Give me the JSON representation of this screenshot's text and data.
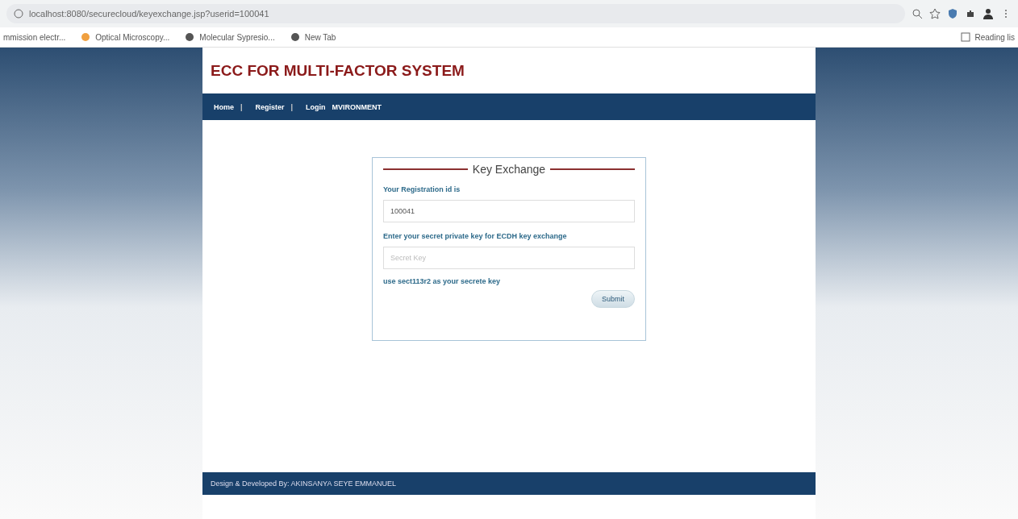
{
  "browser": {
    "url": "localhost:8080/securecloud/keyexchange.jsp?userid=100041",
    "bookmarks": [
      {
        "label": "mmission electr..."
      },
      {
        "label": "Optical Microscopy..."
      },
      {
        "label": "Molecular Sypresio..."
      },
      {
        "label": "New Tab"
      }
    ],
    "reading_list": "Reading lis"
  },
  "site": {
    "title": "ECC FOR MULTI-FACTOR SYSTEM",
    "nav": [
      {
        "label": "Home",
        "separator": "|"
      },
      {
        "label": "Register",
        "separator": "|"
      },
      {
        "label": "Login"
      },
      {
        "label": "MVIRONMENT"
      }
    ],
    "form": {
      "legend": "Key Exchange",
      "id_label": "Your Registration id is",
      "id_value": "100041",
      "key_label": "Enter your secret private key for ECDH key exchange",
      "key_placeholder": "Secret Key",
      "hint": "use sect113r2 as your secrete key",
      "submit": "Submit"
    },
    "footer": "Design & Developed By: AKINSANYA SEYE EMMANUEL"
  }
}
